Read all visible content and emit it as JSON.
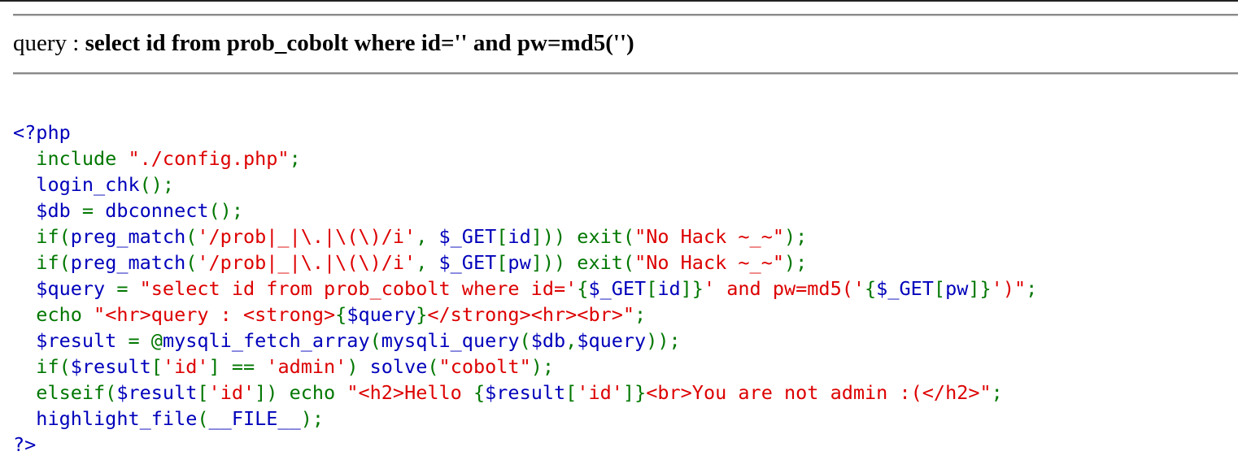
{
  "query_prefix": "query : ",
  "query_text": "select id from prob_cobolt where id='' and pw=md5('')",
  "colors": {
    "default": "#0000bb",
    "keyword": "#007700",
    "string": "#dd0000",
    "text": "#000000"
  },
  "source_lines": [
    [
      [
        "default",
        "<?php"
      ]
    ],
    [
      [
        "keyword",
        "  include "
      ],
      [
        "string",
        "\"./config.php\""
      ],
      [
        "keyword",
        ";"
      ]
    ],
    [
      [
        "default",
        "  login_chk"
      ],
      [
        "keyword",
        "();"
      ]
    ],
    [
      [
        "default",
        "  $db "
      ],
      [
        "keyword",
        "= "
      ],
      [
        "default",
        "dbconnect"
      ],
      [
        "keyword",
        "();"
      ]
    ],
    [
      [
        "keyword",
        "  if("
      ],
      [
        "default",
        "preg_match"
      ],
      [
        "keyword",
        "("
      ],
      [
        "string",
        "'/prob|_|\\.|\\(\\)/i'"
      ],
      [
        "keyword",
        ", "
      ],
      [
        "default",
        "$_GET"
      ],
      [
        "keyword",
        "["
      ],
      [
        "default",
        "id"
      ],
      [
        "keyword",
        "])) exit("
      ],
      [
        "string",
        "\"No Hack ~_~\""
      ],
      [
        "keyword",
        ");"
      ]
    ],
    [
      [
        "keyword",
        "  if("
      ],
      [
        "default",
        "preg_match"
      ],
      [
        "keyword",
        "("
      ],
      [
        "string",
        "'/prob|_|\\.|\\(\\)/i'"
      ],
      [
        "keyword",
        ", "
      ],
      [
        "default",
        "$_GET"
      ],
      [
        "keyword",
        "["
      ],
      [
        "default",
        "pw"
      ],
      [
        "keyword",
        "])) exit("
      ],
      [
        "string",
        "\"No Hack ~_~\""
      ],
      [
        "keyword",
        ");"
      ]
    ],
    [
      [
        "default",
        "  $query "
      ],
      [
        "keyword",
        "= "
      ],
      [
        "string",
        "\"select id from prob_cobolt where id='"
      ],
      [
        "keyword",
        "{"
      ],
      [
        "default",
        "$_GET"
      ],
      [
        "keyword",
        "["
      ],
      [
        "default",
        "id"
      ],
      [
        "keyword",
        "]}"
      ],
      [
        "string",
        "' and pw=md5('"
      ],
      [
        "keyword",
        "{"
      ],
      [
        "default",
        "$_GET"
      ],
      [
        "keyword",
        "["
      ],
      [
        "default",
        "pw"
      ],
      [
        "keyword",
        "]}"
      ],
      [
        "string",
        "')\""
      ],
      [
        "keyword",
        ";"
      ]
    ],
    [
      [
        "keyword",
        "  echo "
      ],
      [
        "string",
        "\"<hr>query : <strong>"
      ],
      [
        "keyword",
        "{"
      ],
      [
        "default",
        "$query"
      ],
      [
        "keyword",
        "}"
      ],
      [
        "string",
        "</strong><hr><br>\""
      ],
      [
        "keyword",
        ";"
      ]
    ],
    [
      [
        "default",
        "  $result "
      ],
      [
        "keyword",
        "= @"
      ],
      [
        "default",
        "mysqli_fetch_array"
      ],
      [
        "keyword",
        "("
      ],
      [
        "default",
        "mysqli_query"
      ],
      [
        "keyword",
        "("
      ],
      [
        "default",
        "$db"
      ],
      [
        "keyword",
        ","
      ],
      [
        "default",
        "$query"
      ],
      [
        "keyword",
        "));"
      ]
    ],
    [
      [
        "keyword",
        "  if("
      ],
      [
        "default",
        "$result"
      ],
      [
        "keyword",
        "["
      ],
      [
        "string",
        "'id'"
      ],
      [
        "keyword",
        "] == "
      ],
      [
        "string",
        "'admin'"
      ],
      [
        "keyword",
        ") "
      ],
      [
        "default",
        "solve"
      ],
      [
        "keyword",
        "("
      ],
      [
        "string",
        "\"cobolt\""
      ],
      [
        "keyword",
        ");"
      ]
    ],
    [
      [
        "keyword",
        "  elseif("
      ],
      [
        "default",
        "$result"
      ],
      [
        "keyword",
        "["
      ],
      [
        "string",
        "'id'"
      ],
      [
        "keyword",
        "]) echo "
      ],
      [
        "string",
        "\"<h2>Hello "
      ],
      [
        "keyword",
        "{"
      ],
      [
        "default",
        "$result"
      ],
      [
        "keyword",
        "["
      ],
      [
        "string",
        "'id'"
      ],
      [
        "keyword",
        "]}"
      ],
      [
        "string",
        "<br>You are not admin :(</h2>\""
      ],
      [
        "keyword",
        ";"
      ]
    ],
    [
      [
        "default",
        "  highlight_file"
      ],
      [
        "keyword",
        "("
      ],
      [
        "default",
        "__FILE__"
      ],
      [
        "keyword",
        ");"
      ]
    ],
    [
      [
        "default",
        "?>"
      ]
    ]
  ]
}
